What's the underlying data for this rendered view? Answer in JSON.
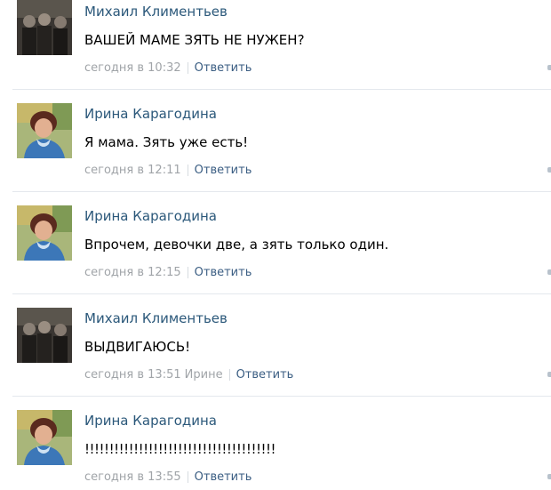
{
  "comments": [
    {
      "author": "Михаил Климентьев",
      "avatar": "photo-man-group",
      "text": "ВАШЕЙ МАМЕ ЗЯТЬ НЕ НУЖЕН?",
      "time": "сегодня в 10:32",
      "addressee": "",
      "reply_label": "Ответить"
    },
    {
      "author": "Ирина Карагодина",
      "avatar": "photo-woman",
      "text": "Я мама. Зять уже есть!",
      "time": "сегодня в 12:11",
      "addressee": "",
      "reply_label": "Ответить"
    },
    {
      "author": "Ирина Карагодина",
      "avatar": "photo-woman",
      "text": "Впрочем, девочки две, а зять только один.",
      "time": "сегодня в 12:15",
      "addressee": "",
      "reply_label": "Ответить"
    },
    {
      "author": "Михаил Климентьев",
      "avatar": "photo-man-group",
      "text": "ВЫДВИГАЮСЬ!",
      "time": "сегодня в 13:51",
      "addressee": "Ирине",
      "reply_label": "Ответить"
    },
    {
      "author": "Ирина Карагодина",
      "avatar": "photo-woman",
      "text": "!!!!!!!!!!!!!!!!!!!!!!!!!!!!!!!!!!!!!!!",
      "time": "сегодня в 13:55",
      "addressee": "",
      "reply_label": "Ответить"
    }
  ],
  "colors": {
    "author": "#2b587a",
    "reply": "#3b5e83",
    "meta": "#a0a4a8",
    "divider": "#e4e8ed"
  }
}
